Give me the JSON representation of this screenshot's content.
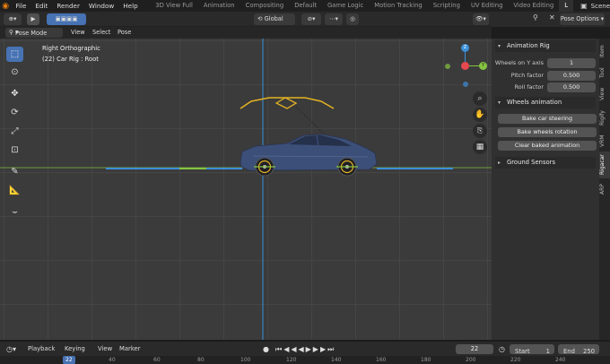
{
  "topbar": {
    "menus": [
      "File",
      "Edit",
      "Render",
      "Window",
      "Help"
    ],
    "workspaces": [
      "3D View Full",
      "Animation",
      "Compositing",
      "Default",
      "Game Logic",
      "Motion Tracking",
      "Scripting",
      "UV Editing",
      "Video Editing",
      "L"
    ],
    "scene": "Scene"
  },
  "header": {
    "transform_orientation": "Global",
    "options_label": "Pose Options"
  },
  "header2": {
    "mode": "Pose Mode",
    "menus": [
      "View",
      "Select",
      "Pose"
    ]
  },
  "viewport": {
    "view_name": "Right Orthographic",
    "object_info": "(22) Car Rig : Root"
  },
  "gizmo": {
    "y_label": "Y",
    "z_label": "Z"
  },
  "npanel": {
    "sections": {
      "animation_rig": "Animation Rig",
      "wheels_animation": "Wheels animation",
      "ground_sensors": "Ground Sensors"
    },
    "props": [
      {
        "label": "Wheels on Y axis",
        "value": "1"
      },
      {
        "label": "Pitch factor",
        "value": "0.500"
      },
      {
        "label": "Roll factor",
        "value": "0.500"
      }
    ],
    "buttons": [
      "Bake car steering",
      "Bake wheels rotation",
      "Clear baked animation"
    ],
    "tabs": [
      "Item",
      "Tool",
      "View",
      "Rigify",
      "VRM",
      "Rigacar",
      "ARP"
    ]
  },
  "timeline": {
    "menus": [
      "Playback",
      "Keying",
      "View",
      "Marker"
    ],
    "current_frame": "22",
    "start_label": "Start",
    "start": "1",
    "end_label": "End",
    "end": "250",
    "ruler": [
      "22",
      "40",
      "60",
      "80",
      "100",
      "120",
      "140",
      "160",
      "180",
      "200",
      "220",
      "240"
    ]
  },
  "colors": {
    "accent": "#4772b3",
    "x_axis": "#e6484f",
    "y_axis": "#86c440",
    "z_axis": "#3a8fd9",
    "bone": "#e3b323",
    "car_body": "#3c4f78"
  }
}
